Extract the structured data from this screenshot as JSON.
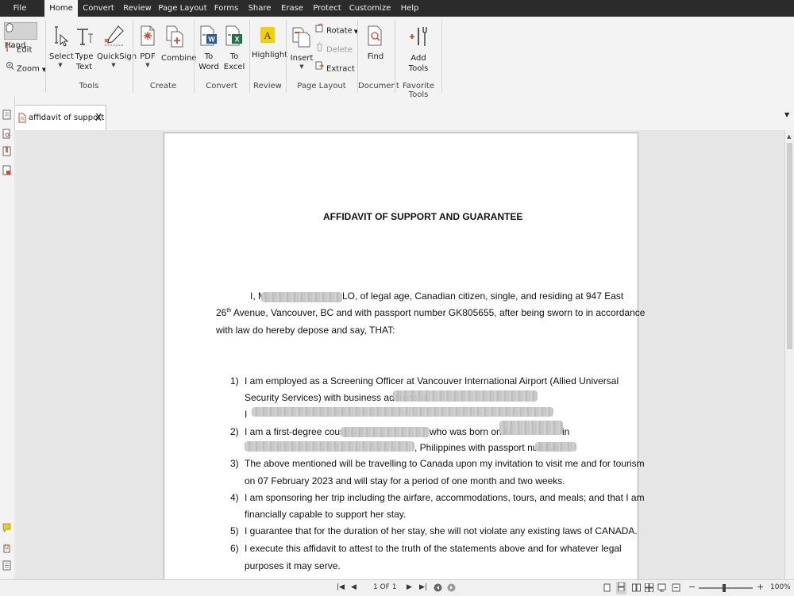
{
  "menubar": {
    "items": [
      "File",
      "Home",
      "Convert",
      "Review",
      "Page Layout",
      "Forms",
      "Share",
      "Erase",
      "Protect",
      "Customize",
      "Help"
    ]
  },
  "ribbon": {
    "hand": "Hand",
    "edit": "Edit",
    "zoom": "Zoom",
    "select": "Select",
    "type_text": [
      "Type",
      "Text"
    ],
    "quicksign": "QuickSign",
    "pdf": "PDF",
    "combine": "Combine",
    "to_word": [
      "To",
      "Word"
    ],
    "to_excel": [
      "To",
      "Excel"
    ],
    "highlight": "Highlight",
    "insert": "Insert",
    "rotate": "Rotate",
    "delete": "Delete",
    "extract": "Extract",
    "find": "Find",
    "add_tools": [
      "Add",
      "Tools"
    ],
    "groups": [
      "Tools",
      "Create",
      "Convert",
      "Review",
      "Page Layout",
      "Document",
      "Favorite Tools"
    ]
  },
  "tab": {
    "name": "affidavit of support",
    "close": "X"
  },
  "document": {
    "title": "AFFIDAVIT OF SUPPORT AND GUARANTEE",
    "intro": [
      {
        "a": "I, M",
        "b": "LO, of legal age, Canadian citizen, single, and residing at 947 East"
      },
      {
        "a": "26",
        "sup": "th",
        "b": " Avenue, Vancouver, BC and with passport number GK805655, after being sworn to in accordance"
      },
      {
        "a": "with law do hereby depose and say, THAT:"
      }
    ],
    "items": [
      {
        "num": "1)",
        "lines": [
          "I am employed as a Screening Officer at Vancouver International Airport (Allied Universal",
          "Security Services) with business address at",
          "I"
        ]
      },
      {
        "num": "2)",
        "lines": [
          "I am a first-degree cousin of",
          "who was born on N",
          ", Philippines with passport number"
        ],
        "line2_in": "in"
      },
      {
        "num": "3)",
        "lines": [
          "The above mentioned will be travelling to Canada upon my invitation to visit me and for tourism",
          "on 07 February 2023 and will stay for a period of one month and two weeks."
        ]
      },
      {
        "num": "4)",
        "lines": [
          "I am sponsoring her trip including the airfare, accommodations, tours, and meals; and that I am",
          "financially capable to support her stay."
        ]
      },
      {
        "num": "5)",
        "lines": [
          "I guarantee that for the duration of her stay, she will not violate any existing laws of CANADA."
        ]
      },
      {
        "num": "6)",
        "lines": [
          "I execute this affidavit to attest to the truth of the statements above and for whatever legal",
          "purposes it may serve."
        ]
      }
    ]
  },
  "status": {
    "page": "1 OF 1",
    "zoom": "100%",
    "minus": "−",
    "plus": "+"
  },
  "colors": {
    "menubar": "#2b2b2b",
    "ribbon": "#f3f3f3",
    "word": "#2b579a",
    "excel": "#1e7145",
    "pdf_red": "#d9472b",
    "highlight": "#f5d000"
  }
}
